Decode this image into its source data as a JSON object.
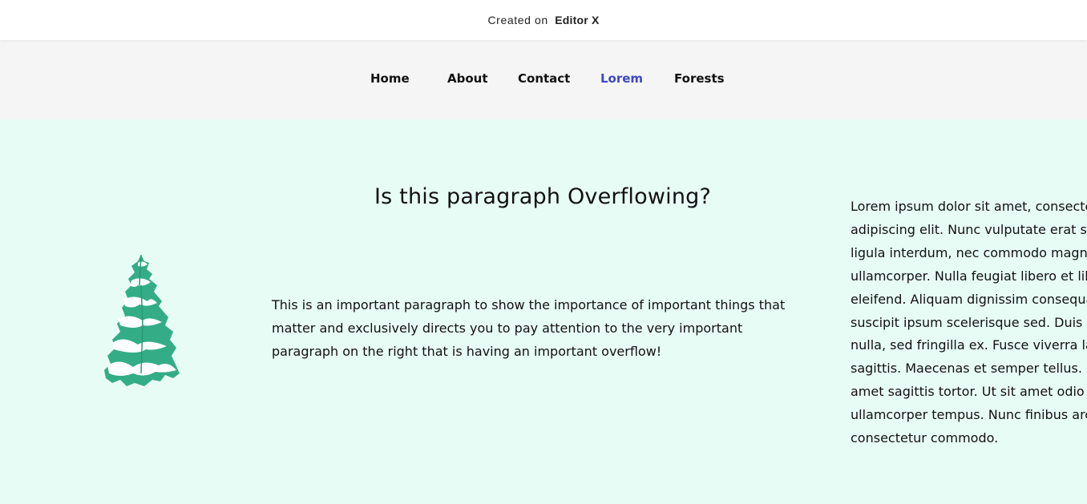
{
  "topbar": {
    "prefix": "Created on",
    "brand": "Editor X"
  },
  "nav": {
    "items": [
      {
        "label": "Home",
        "active": false
      },
      {
        "label": "About",
        "active": false
      },
      {
        "label": "Contact",
        "active": false
      },
      {
        "label": "Lorem",
        "active": true
      },
      {
        "label": "Forests",
        "active": false
      }
    ]
  },
  "main": {
    "heading": "Is this paragraph Overflowing?",
    "paragraph": "This is an important paragraph to show the importance of important things that matter and exclusively directs you to pay attention to the very important paragraph on the right that is having an important overflow!",
    "overflow_lines": [
      "Lorem ipsum dolor sit amet, consectetur",
      "adipiscing elit. Nunc vulputate erat sit amet",
      "ligula interdum, nec commodo magna",
      "ullamcorper. Nulla feugiat libero et libero",
      "eleifend. Aliquam dignissim consequat",
      "suscipit ipsum scelerisque sed. Duis a",
      "nulla, sed fringilla ex. Fusce viverra lacus",
      "sagittis. Maecenas et semper tellus. Fusce",
      "amet sagittis tortor. Ut sit amet odio ut",
      "ullamcorper tempus. Nunc finibus arcu",
      "consectetur commodo."
    ]
  },
  "colors": {
    "nav_active": "#3d47c9",
    "section_bg": "#e8fcf6",
    "nav_bg": "#f5f5f5",
    "tree": "#34ad86"
  },
  "icons": {
    "tree": "snowy-pine-tree-icon"
  }
}
